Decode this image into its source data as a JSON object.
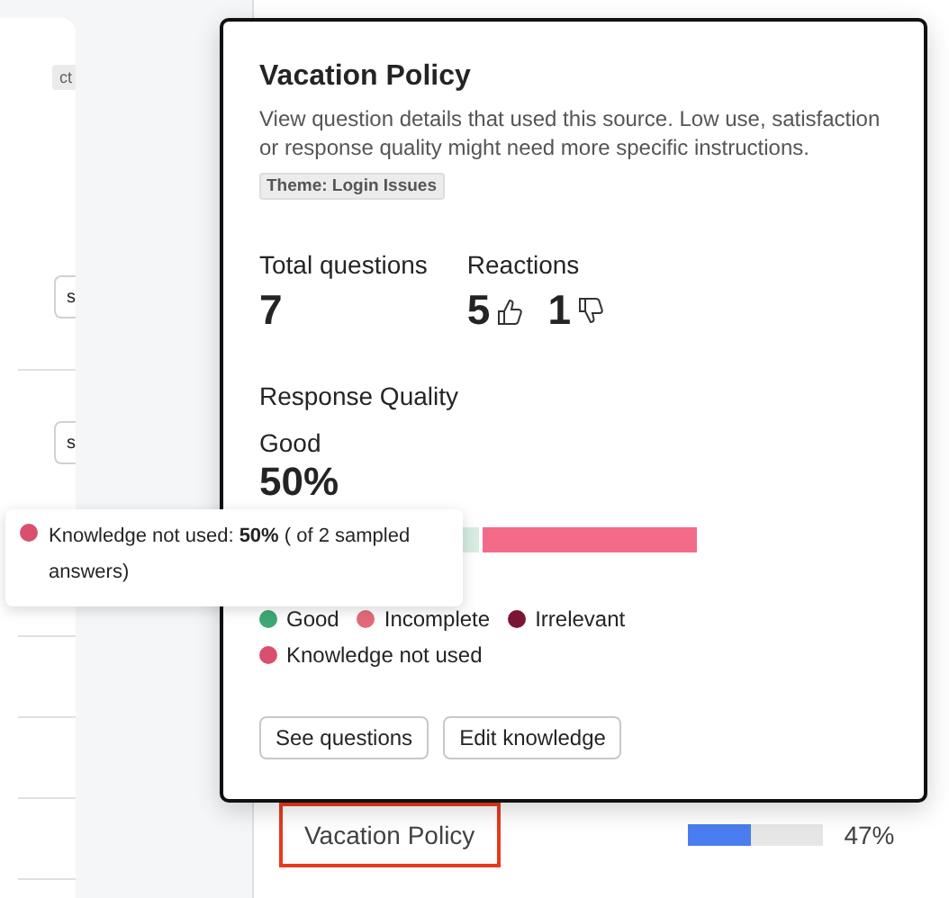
{
  "left_card": {
    "tag": "ct",
    "buttons": [
      "s",
      "s"
    ]
  },
  "source_row": {
    "name": "Vacation Policy",
    "highlighted": true,
    "level": 0.47,
    "reading": "47%"
  },
  "popover": {
    "title": "Vacation Policy",
    "description": "View question details that used this source. Low use, satisfaction or response quality might need more specific instructions.",
    "tag": "Theme: Login Issues",
    "stats": [
      {
        "label": "Total questions",
        "kind": "count",
        "value": "7"
      },
      {
        "label": "Reactions",
        "kind": "reactions",
        "up": "5",
        "down": "1"
      }
    ],
    "quality": {
      "heading": "Response Quality",
      "label": "Good",
      "value": "50%",
      "segments": [
        {
          "level": 0.5,
          "color": "#d7ede2"
        },
        {
          "level": 0.5,
          "color": "#f46b8a"
        }
      ],
      "legend": [
        {
          "label": "Good",
          "color": "#3fa876"
        },
        {
          "label": "Incomplete",
          "color": "#e36b78"
        },
        {
          "label": "Irrelevant",
          "color": "#7b1536"
        },
        {
          "label": "Knowledge not used",
          "color": "#d9506e"
        }
      ]
    },
    "buttons": [
      "See questions",
      "Edit knowledge"
    ]
  },
  "tooltip": {
    "color": "#d9506e",
    "text": "Knowledge not used: **50%** ( of 2 sampled answers)"
  }
}
